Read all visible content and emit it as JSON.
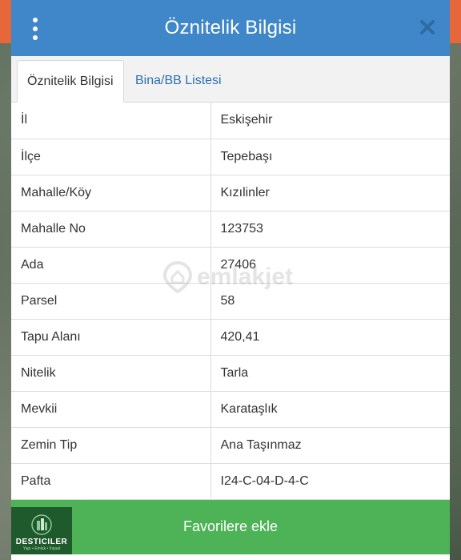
{
  "header": {
    "title": "Öznitelik Bilgisi"
  },
  "tabs": [
    {
      "label": "Öznitelik Bilgisi",
      "active": true
    },
    {
      "label": "Bina/BB Listesi",
      "active": false
    }
  ],
  "rows": [
    {
      "key": "İl",
      "value": "Eskişehir"
    },
    {
      "key": "İlçe",
      "value": "Tepebaşı"
    },
    {
      "key": "Mahalle/Köy",
      "value": "Kızılinler"
    },
    {
      "key": "Mahalle No",
      "value": "123753"
    },
    {
      "key": "Ada",
      "value": "27406"
    },
    {
      "key": "Parsel",
      "value": "58"
    },
    {
      "key": "Tapu Alanı",
      "value": "420,41"
    },
    {
      "key": "Nitelik",
      "value": "Tarla"
    },
    {
      "key": "Mevkii",
      "value": "Karataşlık"
    },
    {
      "key": "Zemin Tip",
      "value": "Ana Taşınmaz"
    },
    {
      "key": "Pafta",
      "value": "I24-C-04-D-4-C"
    }
  ],
  "footer": {
    "favorite_label": "Favorilere ekle"
  },
  "logo": {
    "text": "DESTICILER",
    "subtext": "Yapı • Emlak • İnşaat"
  },
  "watermark": {
    "text": "emlakjet"
  },
  "colors": {
    "header": "#3f87c9",
    "footer": "#4db356",
    "tab_link": "#2a6fb0",
    "top_strip": "#e5673a"
  },
  "icons": {
    "menu": "kebab-menu-icon",
    "close": "close-icon",
    "watermark": "location-house-icon"
  }
}
